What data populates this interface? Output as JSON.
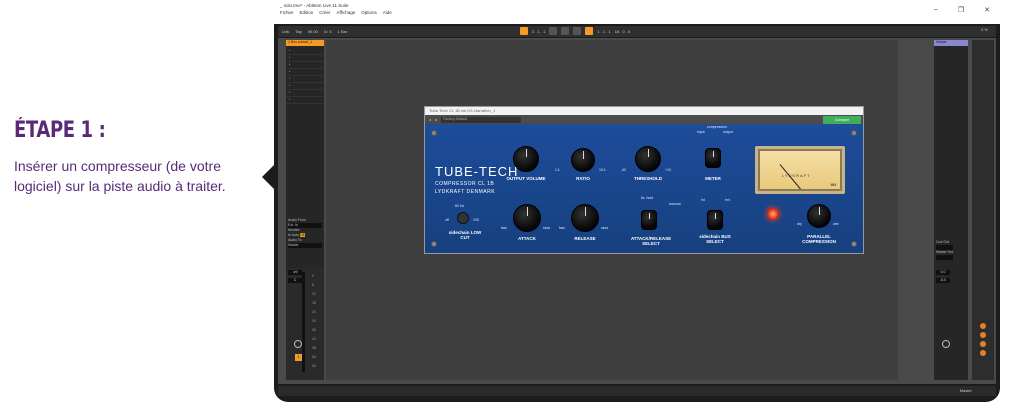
{
  "left_panel": {
    "title": "ÉTAPE 1 :",
    "description": "Insérer un compresseur (de votre logiciel) sur la piste audio à traiter."
  },
  "window": {
    "title": "_ solo.tme* - Ableton Live 11 Suite",
    "menu": [
      "Fichier",
      "Edition",
      "Créer",
      "Affichage",
      "Options",
      "Aide"
    ]
  },
  "transport": {
    "link": "Link",
    "tap": "Tap",
    "tempo": "90.00",
    "signature": "4 / 4",
    "quant": "1 Bar",
    "position": "2 . 1 . 1",
    "loop_pos": "1 . 1 . 1",
    "loop_len": "16 . 0 . 0",
    "cpu": "0 %"
  },
  "tracks": {
    "left_track_name": "1 Bus suboct_1",
    "audio_from_label": "Audio From",
    "audio_from_value": "Ext. In",
    "monitor_label": "Monitor",
    "monitor_options": [
      "In",
      "Auto",
      "Off"
    ],
    "audio_to_label": "Audio To",
    "audio_to_value": "Master",
    "volume": "-inf",
    "pan": "C",
    "track_number": "1",
    "master_name": "Master",
    "master_volume": "0.0",
    "master_pan": "-6.0",
    "cue_out_label": "Cue Out",
    "master_out_label": "Master Out",
    "status_master": "Master"
  },
  "meter_scale": [
    "0",
    "6",
    "12",
    "18",
    "24",
    "30",
    "36",
    "42",
    "48",
    "54",
    "60"
  ],
  "plugin": {
    "window_title": "Tube-Tech CL 1B mk II/1-Narration_1",
    "preset": "Factory Default",
    "brand": "TUBE-TECH",
    "model": "COMPRESSOR   CL 1B",
    "maker": "LYDKRAFT   DENMARK",
    "knobs": {
      "output_volume": "OUTPUT VOLUME",
      "ratio": "RATIO",
      "threshold": "THRESHOLD",
      "meter": "METER",
      "attack": "ATTACK",
      "release": "RELEASE",
      "attack_release": "ATTACK/RELEASE SELECT",
      "sidechain_bus": "sidechain BUS SELECT",
      "parallel": "PARALLEL COMPRESSION",
      "sidechain_lowcut": "sidechain LOW CUT"
    },
    "ticks": {
      "fast": "fast",
      "slow": "slow",
      "ratio_min": "1:1",
      "ratio_max": "10:1",
      "thr_min": "-40",
      "thr_max": "+10",
      "dry": "dry",
      "wet": "wet",
      "hz60": "60 Hz",
      "off": "off",
      "hz225": "225",
      "fix_hold": "fix. hold",
      "manual": "manual",
      "input": "input",
      "compression": "compression",
      "output": "output",
      "int": "int",
      "ext": "ext"
    },
    "vu_brand": "LYDKRAFT",
    "vu_mark": "VU",
    "green_button": "Compare"
  }
}
